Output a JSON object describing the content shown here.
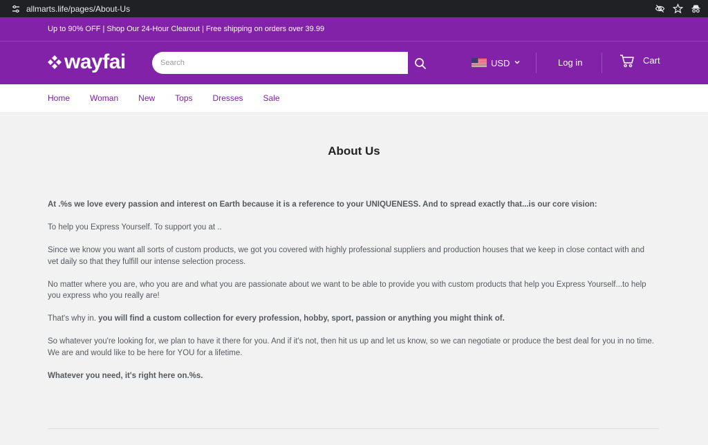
{
  "browser": {
    "url": "allmarts.life/pages/About-Us"
  },
  "announcement": {
    "text": "Up to 90% OFF | Shop Our 24-Hour Clearout | Free shipping on orders over 39.99"
  },
  "header": {
    "logo_text": "wayfai",
    "search_placeholder": "Search",
    "currency": "USD",
    "login_label": "Log in",
    "cart_label": "Cart"
  },
  "nav": {
    "items": [
      "Home",
      "Woman",
      "New",
      "Tops",
      "Dresses",
      "Sale"
    ]
  },
  "page": {
    "title": "About Us",
    "p1": "At .%s we love every passion and interest on Earth because it is a reference to your UNIQUENESS. And to spread exactly that...is our core vision:",
    "p2": "To help you Express Yourself. To support you at ..",
    "p3": "Since we know you want all sorts of custom products, we got you covered with highly professional suppliers and production houses that we keep in close contact with and vet daily so that they fulfill our intense selection process.",
    "p4": "No matter where you are, who you are and what you are passionate about we want to be able to provide you with custom products that help you Express Yourself...to help you express who you really are!",
    "p5_prefix": "That's why in. ",
    "p5_bold": "you will find a custom collection for every profession, hobby, sport, passion or anything you might think of.",
    "p6": "So whatever you're looking for, we plan to have it there for you. And if it's not, then hit us up and let us know, so we can negotiate or produce the best deal for you in no time. We are and would like to be here for YOU for a lifetime.",
    "p7": "Whatever you need, it's right here on.%s."
  },
  "colors": {
    "brand_purple": "#8222a8",
    "nav_text": "#7b1fa2",
    "browser_bar": "#202124"
  }
}
